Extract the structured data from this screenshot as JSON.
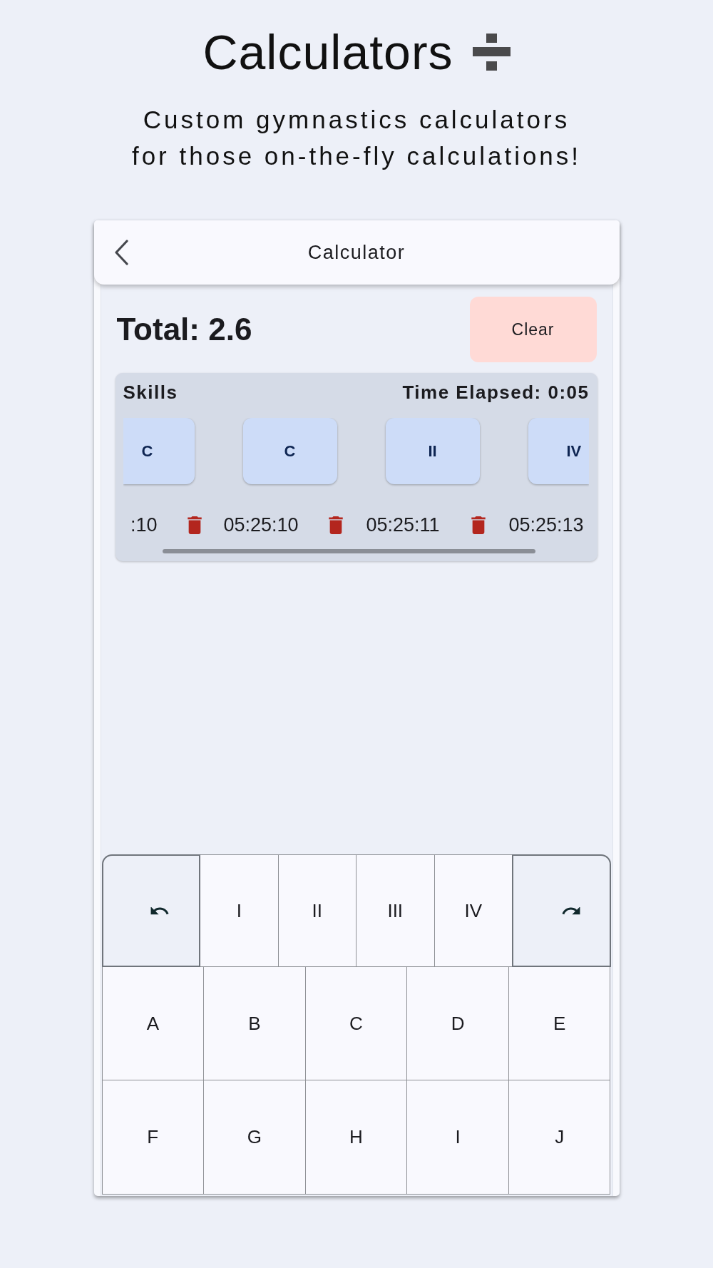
{
  "header": {
    "title": "Calculators",
    "subtitle": "Custom gymnastics calculators\nfor those on-the-fly calculations!"
  },
  "app_bar": {
    "title": "Calculator"
  },
  "summary": {
    "total": "Total: 2.6",
    "clear_button": "Clear"
  },
  "skills": {
    "title": "Skills",
    "time_elapsed": "Time Elapsed: 0:05",
    "items": [
      {
        "label": "C",
        "time": ":10"
      },
      {
        "label": "C",
        "time": "05:25:10"
      },
      {
        "label": "II",
        "time": "05:25:11"
      },
      {
        "label": "IV",
        "time": "05:25:13"
      }
    ]
  },
  "keypad": {
    "rows": [
      [
        {
          "kind": "undo"
        },
        {
          "kind": "key",
          "label": "I"
        },
        {
          "kind": "key",
          "label": "II"
        },
        {
          "kind": "key",
          "label": "III"
        },
        {
          "kind": "key",
          "label": "IV"
        },
        {
          "kind": "redo"
        }
      ],
      [
        {
          "kind": "key",
          "label": "A"
        },
        {
          "kind": "key",
          "label": "B"
        },
        {
          "kind": "key",
          "label": "C"
        },
        {
          "kind": "key",
          "label": "D"
        },
        {
          "kind": "key",
          "label": "E"
        }
      ],
      [
        {
          "kind": "key",
          "label": "F"
        },
        {
          "kind": "key",
          "label": "G"
        },
        {
          "kind": "key",
          "label": "H"
        },
        {
          "kind": "key",
          "label": "I"
        },
        {
          "kind": "key",
          "label": "J"
        }
      ]
    ]
  }
}
